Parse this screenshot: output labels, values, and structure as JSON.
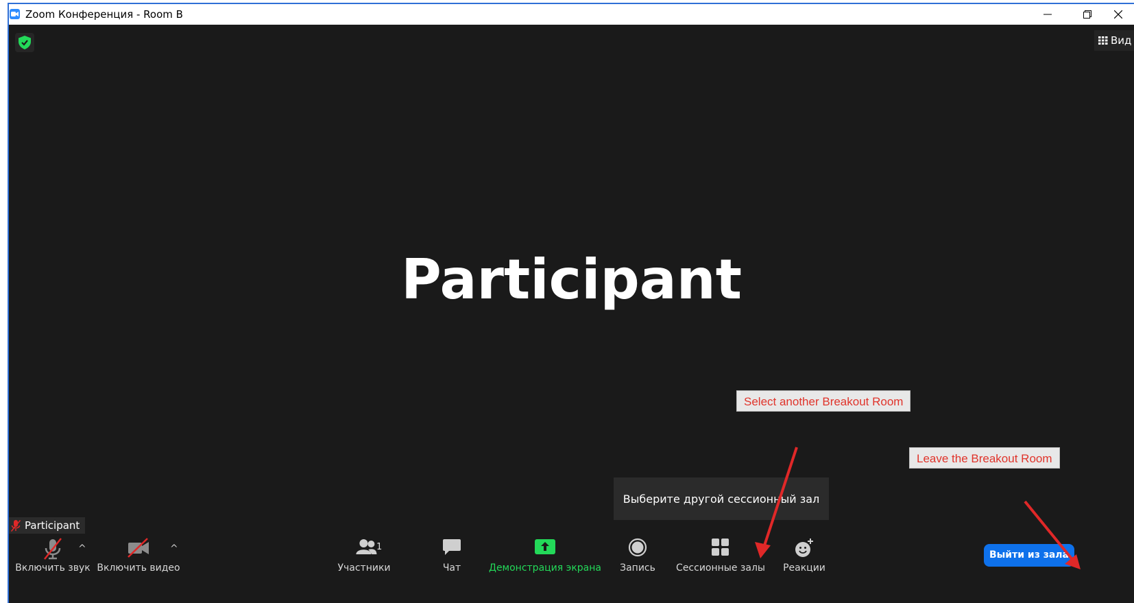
{
  "window": {
    "title": "Zoom Конференция - Room B",
    "controls": {
      "minimize": "minimize",
      "maximize": "restore",
      "close": "close"
    }
  },
  "top_right": {
    "view_label": "Вид"
  },
  "video": {
    "participant_name": "Participant"
  },
  "name_tag": {
    "label": "Participant"
  },
  "tooltip": {
    "text": "Выберите другой сессионный зал"
  },
  "annotations": [
    {
      "text": "Select another Breakout Room"
    },
    {
      "text": "Leave the Breakout Room"
    }
  ],
  "toolbar": {
    "unmute_label": "Включить звук",
    "start_video_label": "Включить видео",
    "participants_label": "Участники",
    "participants_count": "1",
    "chat_label": "Чат",
    "share_label": "Демонстрация экрана",
    "record_label": "Запись",
    "breakout_label": "Сессионные залы",
    "reactions_label": "Реакции",
    "caret": "^"
  },
  "leave_button": {
    "label": "Выйти из зала"
  },
  "colors": {
    "accent_blue": "#0e71eb",
    "share_green": "#23d959",
    "annotation_red": "#e0342b",
    "muted_red": "#e02828",
    "background": "#1a1a1a"
  }
}
